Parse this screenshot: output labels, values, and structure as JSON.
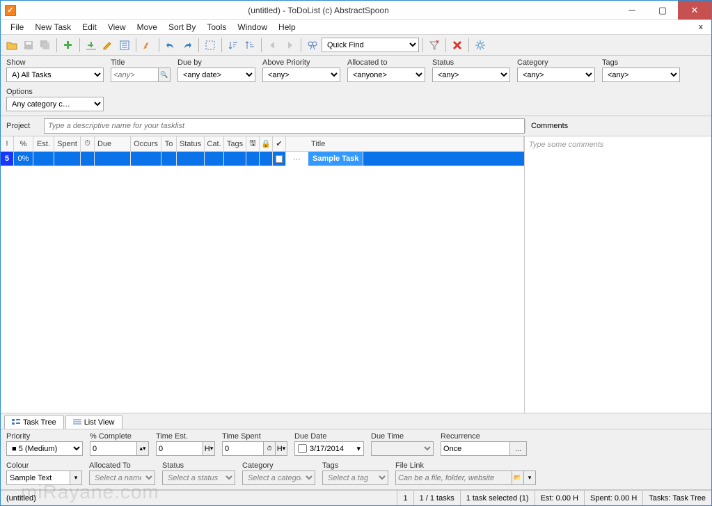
{
  "window": {
    "title": "(untitled) - ToDoList (c) AbstractSpoon"
  },
  "menu": [
    "File",
    "New Task",
    "Edit",
    "View",
    "Move",
    "Sort By",
    "Tools",
    "Window",
    "Help"
  ],
  "toolbar": {
    "quick_find_placeholder": "Quick Find"
  },
  "filters": {
    "show": {
      "label": "Show",
      "value": "A)  All Tasks"
    },
    "title": {
      "label": "Title",
      "placeholder": "<any>"
    },
    "due_by": {
      "label": "Due by",
      "value": "<any date>"
    },
    "above_priority": {
      "label": "Above Priority",
      "value": "<any>"
    },
    "allocated_to": {
      "label": "Allocated to",
      "value": "<anyone>"
    },
    "status": {
      "label": "Status",
      "value": "<any>"
    },
    "category": {
      "label": "Category",
      "value": "<any>"
    },
    "tags": {
      "label": "Tags",
      "value": "<any>"
    },
    "options": {
      "label": "Options",
      "value": "Any category c…"
    }
  },
  "project": {
    "label": "Project",
    "placeholder": "Type a descriptive name for your tasklist",
    "comments_label": "Comments"
  },
  "columns": {
    "priority": "!",
    "pct": "%",
    "est": "Est.",
    "spent": "Spent",
    "clock": "⏱",
    "due": "Due",
    "occurs": "Occurs",
    "to": "To",
    "status": "Status",
    "cat": "Cat.",
    "tags": "Tags",
    "disk": "🖫",
    "lock": "🔒",
    "check": "✔",
    "title": "Title"
  },
  "task": {
    "priority": "5",
    "pct": "0%",
    "title": "Sample Task"
  },
  "comments": {
    "placeholder": "Type some comments"
  },
  "tabs": {
    "task_tree": "Task Tree",
    "list_view": "List View"
  },
  "props": {
    "priority": {
      "label": "Priority",
      "value": "5 (Medium)"
    },
    "pct_complete": {
      "label": "% Complete",
      "value": "0"
    },
    "time_est": {
      "label": "Time Est.",
      "value": "0",
      "unit": "H"
    },
    "time_spent": {
      "label": "Time Spent",
      "value": "0",
      "clock": "⏱",
      "unit": "H"
    },
    "due_date": {
      "label": "Due Date",
      "value": "3/17/2014"
    },
    "due_time": {
      "label": "Due Time",
      "value": ""
    },
    "recurrence": {
      "label": "Recurrence",
      "value": "Once",
      "btn": "…"
    },
    "colour": {
      "label": "Colour",
      "value": "Sample Text"
    },
    "allocated_to": {
      "label": "Allocated To",
      "placeholder": "Select a name"
    },
    "status": {
      "label": "Status",
      "placeholder": "Select a status"
    },
    "category": {
      "label": "Category",
      "placeholder": "Select a category"
    },
    "tags": {
      "label": "Tags",
      "placeholder": "Select a tag"
    },
    "file_link": {
      "label": "File Link",
      "placeholder": "Can be a file, folder, website"
    }
  },
  "statusbar": {
    "file": "(untitled)",
    "sel": "1",
    "count": "1 / 1 tasks",
    "selected": "1 task selected (1)",
    "est": "Est: 0.00 H",
    "spent": "Spent: 0.00 H",
    "view": "Tasks: Task Tree"
  },
  "watermark": "miRayane.com"
}
